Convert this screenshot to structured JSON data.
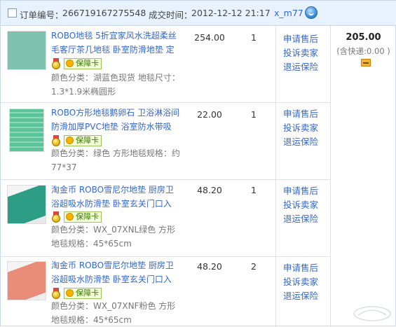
{
  "order": {
    "order_no_label": "订单编号：",
    "order_no": "266719167275548",
    "deal_time_label": "成交时间：",
    "deal_time": "2012-12-12 21:17",
    "buyer": "x_m77",
    "total": "205.00",
    "shipping_note": "(含快递:0.00 )"
  },
  "items": [
    {
      "title_line1": "ROBO地毯 5折宜家风水洗超柔丝",
      "title_line2": "毛客厅茶几地毯 卧室防滑地垫 定",
      "badge": "保障卡",
      "spec_line1": "颜色分类：湖蓝色现货  地毯尺寸：",
      "spec_line2": "1.3*1.9米椭圆形",
      "price": "254.00",
      "qty": "1",
      "thumb_color": "#6fb7a3"
    },
    {
      "title_line1": "ROBO方形地毯鹅卵石 卫浴淋浴间",
      "title_line2": "防滑加厚PVC地垫 浴室防水带吸",
      "badge": "保障卡",
      "spec_line1": "颜色分类：绿色  方形地毯规格：约",
      "spec_line2": "77*37",
      "price": "22.00",
      "qty": "1",
      "thumb_color": "#5cc49a"
    },
    {
      "title_line1": "淘金币 ROBO雪尼尔地垫 厨房卫",
      "title_line2": "浴超吸水防滑垫 卧室玄关门口入",
      "badge": "保障卡",
      "spec_line1": "颜色分类：WX_07XNL绿色  方形",
      "spec_line2": "地毯规格：45*65cm",
      "price": "48.20",
      "qty": "1",
      "thumb_color": "#3aa28a"
    },
    {
      "title_line1": "淘金币 ROBO雪尼尔地垫 厨房卫",
      "title_line2": "浴超吸水防滑垫 卧室玄关门口入",
      "badge": "保障卡",
      "spec_line1": "颜色分类：WX_07XNF粉色  方形",
      "spec_line2": "地毯规格：45*65cm",
      "price": "48.20",
      "qty": "2",
      "thumb_color": "#e98c78"
    }
  ],
  "actions": {
    "refund": "申请售后",
    "complain": "投诉卖家",
    "return_insurance": "退运保险"
  },
  "colors": {
    "header_bg": "#e8f2ff",
    "link": "#3366cc",
    "border": "#c9d7e8"
  }
}
